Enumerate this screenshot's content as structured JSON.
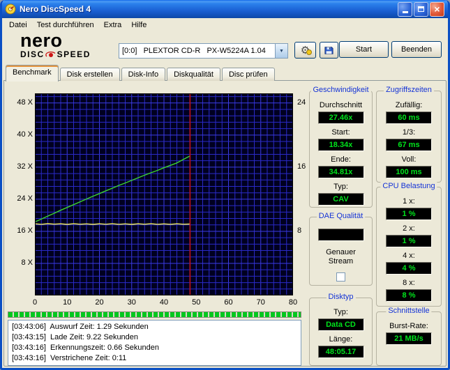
{
  "window": {
    "title": "Nero DiscSpeed 4"
  },
  "menu": {
    "items": [
      "Datei",
      "Test durchführen",
      "Extra",
      "Hilfe"
    ]
  },
  "toolbar": {
    "logo": {
      "top": "nero",
      "disc": "DISC",
      "speed": "SPEED"
    },
    "drive": "[0:0]   PLEXTOR CD-R   PX-W5224A 1.04",
    "start": "Start",
    "quit": "Beenden"
  },
  "tabs": [
    {
      "label": "Benchmark",
      "selected": true
    },
    {
      "label": "Disk erstellen",
      "selected": false
    },
    {
      "label": "Disk-Info",
      "selected": false
    },
    {
      "label": "Diskqualität",
      "selected": false
    },
    {
      "label": "Disc prüfen",
      "selected": false
    }
  ],
  "chart_data": {
    "type": "line",
    "x_axis": {
      "range": [
        0,
        80
      ],
      "ticks": [
        0,
        10,
        20,
        30,
        40,
        50,
        60,
        70,
        80
      ]
    },
    "y_left": {
      "range": [
        0,
        50.4
      ],
      "tick_values": [
        48,
        40,
        32,
        24,
        16,
        8
      ],
      "tick_suffix": " X"
    },
    "y_right": {
      "range": [
        0,
        25.2
      ],
      "tick_values": [
        24,
        16,
        8
      ],
      "tick_suffix": ""
    },
    "grid": {
      "bg": "#000020",
      "color": "#2a2ac8",
      "major_color": "#3c3ce6",
      "x_minor_step": 2,
      "y_minor_step": 1.6
    },
    "end_marker_x": 48.09,
    "end_marker_color": "#c01010",
    "series": [
      {
        "name": "rotation-speed",
        "axis": "right",
        "color": "#f2ee5a",
        "points": [
          [
            0,
            8.93
          ],
          [
            2,
            8.87
          ],
          [
            4,
            8.95
          ],
          [
            6,
            8.89
          ],
          [
            8,
            8.93
          ],
          [
            10,
            8.86
          ],
          [
            12,
            8.94
          ],
          [
            14,
            8.88
          ],
          [
            16,
            8.92
          ],
          [
            18,
            8.86
          ],
          [
            20,
            8.93
          ],
          [
            22,
            8.88
          ],
          [
            24,
            8.94
          ],
          [
            26,
            8.87
          ],
          [
            28,
            8.92
          ],
          [
            30,
            8.86
          ],
          [
            32,
            8.93
          ],
          [
            34,
            8.88
          ],
          [
            36,
            8.94
          ],
          [
            38,
            8.87
          ],
          [
            40,
            8.92
          ],
          [
            42,
            8.87
          ],
          [
            44,
            8.93
          ],
          [
            46,
            8.88
          ],
          [
            48.09,
            8.91
          ]
        ]
      },
      {
        "name": "read-speed",
        "axis": "left",
        "color": "#3ed42e",
        "points": [
          [
            0,
            18.34
          ],
          [
            2,
            19.05
          ],
          [
            4,
            19.8
          ],
          [
            6,
            20.5
          ],
          [
            8,
            21.25
          ],
          [
            10,
            21.95
          ],
          [
            12,
            22.65
          ],
          [
            14,
            23.35
          ],
          [
            16,
            24.05
          ],
          [
            18,
            24.75
          ],
          [
            20,
            25.4
          ],
          [
            22,
            26.1
          ],
          [
            24,
            26.75
          ],
          [
            26,
            27.45
          ],
          [
            28,
            28.05
          ],
          [
            30,
            28.7
          ],
          [
            32,
            29.35
          ],
          [
            34,
            30.0
          ],
          [
            36,
            30.6
          ],
          [
            38,
            31.2
          ],
          [
            40,
            31.85
          ],
          [
            42,
            32.45
          ],
          [
            44,
            33.05
          ],
          [
            46,
            33.9
          ],
          [
            48.09,
            34.81
          ]
        ]
      }
    ]
  },
  "progress": {
    "percent": 100
  },
  "log": {
    "lines": [
      "[03:43:06]  Auswurf Zeit: 1.29 Sekunden",
      "[03:43:15]  Lade Zeit: 9.22 Sekunden",
      "[03:43:16]  Erkennungszeit: 0.66 Sekunden",
      "[03:43:16]  Verstrichene Zeit: 0:11"
    ]
  },
  "panels": {
    "speed": {
      "title": "Geschwindigkeit",
      "fields": [
        {
          "label": "Durchschnitt",
          "value": "27.46x"
        },
        {
          "label": "Start:",
          "value": "18.34x"
        },
        {
          "label": "Ende:",
          "value": "34.81x"
        },
        {
          "label": "Typ:",
          "value": "CAV"
        }
      ]
    },
    "dae": {
      "title": "DAE Qualität",
      "value": "",
      "checkbox_label": "Genauer Stream",
      "checked": false
    },
    "disc": {
      "title": "Disktyp",
      "fields": [
        {
          "label": "Typ:",
          "value": "Data CD"
        },
        {
          "label": "Länge:",
          "value": "48:05.17"
        }
      ]
    },
    "access": {
      "title": "Zugriffszeiten",
      "fields": [
        {
          "label": "Zufällig:",
          "value": "60 ms"
        },
        {
          "label": "1/3:",
          "value": "67 ms"
        },
        {
          "label": "Voll:",
          "value": "100 ms"
        }
      ]
    },
    "cpu": {
      "title": "CPU Belastung",
      "fields": [
        {
          "label": "1 x:",
          "value": "1 %"
        },
        {
          "label": "2 x:",
          "value": "1 %"
        },
        {
          "label": "4 x:",
          "value": "4 %"
        },
        {
          "label": "8 x:",
          "value": "8 %"
        }
      ]
    },
    "iface": {
      "title": "Schnittstelle",
      "fields": [
        {
          "label": "Burst-Rate:",
          "value": "21 MB/s"
        }
      ]
    }
  },
  "colors": {
    "led_text": "#00e41c",
    "panel_title": "#1433d6",
    "progress_green": "#00c81e",
    "window_blue": "#0A4FC4",
    "chart_background": "#000020",
    "chart_grid": "#2a2ac8"
  }
}
